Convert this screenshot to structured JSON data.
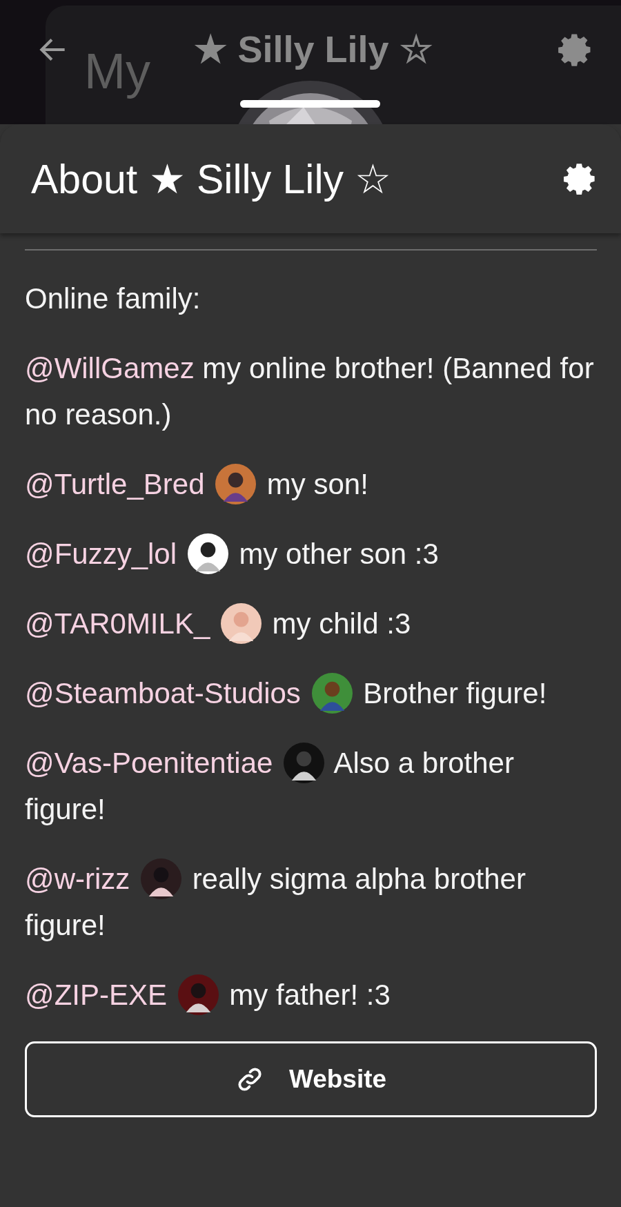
{
  "background": {
    "text": "My",
    "title": "★ Silly Lily ☆"
  },
  "sheet": {
    "title": "About ★ Silly Lily ☆",
    "intro": "Online family:",
    "entries": [
      {
        "mention": "@WillGamez",
        "has_avatar": false,
        "text": "my online brother! (Banned for no reason.)"
      },
      {
        "mention": "@Turtle_Bred",
        "has_avatar": true,
        "text": "my son!"
      },
      {
        "mention": "@Fuzzy_lol",
        "has_avatar": true,
        "text": "my other son :3"
      },
      {
        "mention": "@TAR0MILK_",
        "has_avatar": true,
        "text": "my child :3"
      },
      {
        "mention": "@Steamboat-Studios",
        "has_avatar": true,
        "text": "Brother figure!"
      },
      {
        "mention": "@Vas-Poenitentiae",
        "has_avatar": true,
        "text": "Also a brother figure!"
      },
      {
        "mention": "@w-rizz",
        "has_avatar": true,
        "text": "really sigma alpha brother figure!"
      },
      {
        "mention": "@ZIP-EXE",
        "has_avatar": true,
        "text": "my father! :3"
      }
    ],
    "button": {
      "label": "Website"
    }
  }
}
